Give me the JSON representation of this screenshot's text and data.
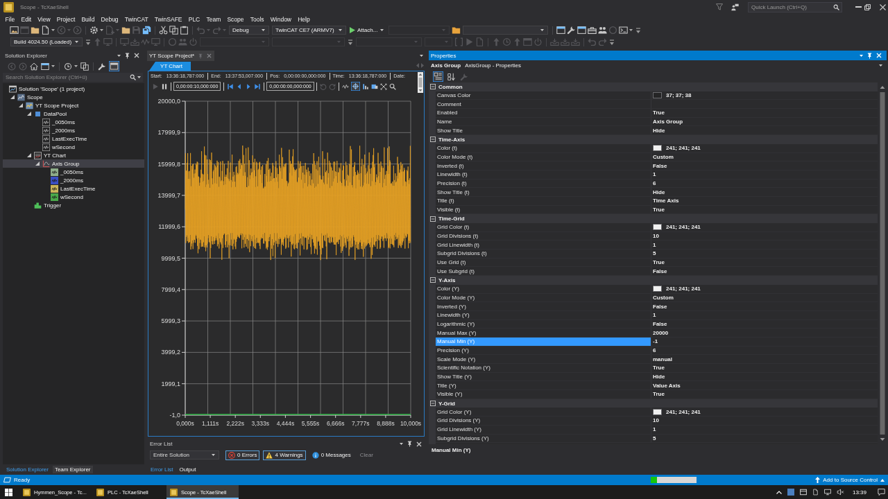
{
  "window": {
    "title": "Scope - TcXaeShell",
    "quick_launch": {
      "placeholder": "Quick Launch (Ctrl+Q)"
    }
  },
  "menu": [
    "File",
    "Edit",
    "View",
    "Project",
    "Build",
    "Debug",
    "TwinCAT",
    "TwinSAFE",
    "PLC",
    "Team",
    "Scope",
    "Tools",
    "Window",
    "Help"
  ],
  "toolbar_1": [
    {
      "kind": "icon",
      "disabled": false
    },
    {
      "kind": "icon",
      "disabled": true
    },
    {
      "kind": "icon",
      "disabled": false
    },
    {
      "kind": "split",
      "disabled": false
    },
    {
      "kind": "split",
      "disabled": true
    },
    {
      "kind": "icon",
      "disabled": true
    },
    {
      "kind": "separator"
    },
    {
      "kind": "split",
      "disabled": false
    },
    {
      "kind": "split",
      "disabled": true
    },
    {
      "kind": "icon",
      "disabled": false
    },
    {
      "kind": "icon",
      "disabled": true
    },
    {
      "kind": "icon",
      "disabled": false
    },
    {
      "kind": "separator"
    },
    {
      "kind": "icon",
      "disabled": false
    },
    {
      "kind": "icon",
      "disabled": false
    },
    {
      "kind": "icon",
      "disabled": false
    },
    {
      "kind": "separator"
    },
    {
      "kind": "split",
      "disabled": true
    },
    {
      "kind": "split",
      "disabled": true
    },
    {
      "kind": "dropdown",
      "value": "Debug",
      "disabled": false
    },
    {
      "kind": "dropdown",
      "value": "TwinCAT CE7 (ARMV7)",
      "disabled": false
    },
    {
      "kind": "button",
      "label": "Attach...",
      "disabled": false
    },
    {
      "kind": "dropdown",
      "disabled": true
    },
    {
      "kind": "icon",
      "disabled": false
    },
    {
      "kind": "dropdown",
      "disabled": false
    },
    {
      "kind": "separator"
    },
    {
      "kind": "icon",
      "disabled": false
    },
    {
      "kind": "icon",
      "disabled": false
    },
    {
      "kind": "icon",
      "disabled": false
    },
    {
      "kind": "icon",
      "disabled": false
    },
    {
      "kind": "icon",
      "disabled": false
    },
    {
      "kind": "icon",
      "disabled": true
    },
    {
      "kind": "split",
      "disabled": false
    },
    {
      "kind": "overflow"
    }
  ],
  "toolbar_2": [
    {
      "kind": "dropdown",
      "value": "Build 4024.50 (Loaded)",
      "disabled": false
    },
    {
      "kind": "overflow"
    },
    {
      "kind": "icon",
      "disabled": true
    },
    {
      "kind": "icon",
      "disabled": true
    },
    {
      "kind": "separator"
    },
    {
      "kind": "icon",
      "disabled": true
    },
    {
      "kind": "icon",
      "disabled": true
    },
    {
      "kind": "icon",
      "disabled": true
    },
    {
      "kind": "icon",
      "disabled": true
    },
    {
      "kind": "separator"
    },
    {
      "kind": "icon",
      "disabled": true
    },
    {
      "kind": "icon",
      "disabled": true
    },
    {
      "kind": "icon",
      "disabled": true
    },
    {
      "kind": "dropdown",
      "disabled": true
    },
    {
      "kind": "dropdown",
      "disabled": true
    },
    {
      "kind": "overflow"
    },
    {
      "kind": "dropdown",
      "disabled": true
    },
    {
      "kind": "dropdown",
      "disabled": true
    },
    {
      "kind": "icon",
      "disabled": true
    },
    {
      "kind": "icon",
      "disabled": true
    },
    {
      "kind": "icon",
      "disabled": true
    },
    {
      "kind": "separator"
    },
    {
      "kind": "icon",
      "disabled": true
    },
    {
      "kind": "icon",
      "disabled": true
    },
    {
      "kind": "icon",
      "disabled": true
    },
    {
      "kind": "icon",
      "disabled": true
    },
    {
      "kind": "icon",
      "disabled": true
    },
    {
      "kind": "separator"
    },
    {
      "kind": "icon",
      "disabled": true
    },
    {
      "kind": "icon",
      "disabled": true
    },
    {
      "kind": "icon",
      "disabled": true
    },
    {
      "kind": "separator"
    },
    {
      "kind": "icon",
      "disabled": true
    },
    {
      "kind": "icon",
      "disabled": true
    },
    {
      "kind": "overflow"
    }
  ],
  "solution_explorer": {
    "title": "Solution Explorer",
    "toolbar": [
      {
        "kind": "icon",
        "disabled": true,
        "selected": false
      },
      {
        "kind": "icon",
        "disabled": true,
        "selected": false
      },
      {
        "kind": "icon",
        "disabled": false,
        "selected": false
      },
      {
        "kind": "split",
        "disabled": false,
        "selected": false
      },
      {
        "kind": "separator"
      },
      {
        "kind": "split",
        "disabled": false,
        "selected": false
      },
      {
        "kind": "icon",
        "disabled": false,
        "selected": false
      },
      {
        "kind": "separator"
      },
      {
        "kind": "icon",
        "disabled": false,
        "selected": false
      },
      {
        "kind": "icon",
        "disabled": false,
        "selected": true
      }
    ],
    "search": {
      "placeholder": "Search Solution Explorer (Ctrl+ü)"
    },
    "tree": [
      {
        "label": "Solution 'Scope' (1 project)",
        "kind": "solution",
        "selected": false,
        "children": [
          {
            "label": "Scope",
            "kind": "scope",
            "expanded": true,
            "selected": false,
            "children": [
              {
                "label": "YT Scope Project",
                "kind": "project",
                "expanded": true,
                "selected": false,
                "children": [
                  {
                    "label": "DataPool",
                    "kind": "datapool",
                    "expanded": true,
                    "selected": false,
                    "children": [
                      {
                        "label": "_0050ms",
                        "kind": "variable",
                        "selected": false
                      },
                      {
                        "label": "_2000ms",
                        "kind": "variable",
                        "selected": false
                      },
                      {
                        "label": "LastExecTime",
                        "kind": "variable",
                        "selected": false
                      },
                      {
                        "label": "wSecond",
                        "kind": "variable",
                        "selected": false
                      }
                    ]
                  },
                  {
                    "label": "YT Chart",
                    "kind": "chart",
                    "expanded": true,
                    "selected": false,
                    "children": [
                      {
                        "label": "Axis Group",
                        "kind": "axis_group",
                        "expanded": true,
                        "selected": true,
                        "children": [
                          {
                            "label": "_0050ms",
                            "kind": "channel",
                            "color": "#8fae8a",
                            "selected": false
                          },
                          {
                            "label": "_2000ms",
                            "kind": "channel",
                            "color": "#3a4fc4",
                            "selected": false
                          },
                          {
                            "label": "LastExecTime",
                            "kind": "channel",
                            "color": "#c9b45a",
                            "selected": false
                          },
                          {
                            "label": "wSecond",
                            "kind": "channel",
                            "color": "#4aa84a",
                            "selected": false
                          }
                        ]
                      }
                    ]
                  },
                  {
                    "label": "Trigger",
                    "kind": "trigger",
                    "selected": false
                  }
                ]
              }
            ]
          }
        ]
      }
    ],
    "tabs": [
      {
        "label": "Solution Explorer",
        "selected": true
      },
      {
        "label": "Team Explorer",
        "selected": false
      }
    ]
  },
  "document": {
    "tabs": [
      {
        "label": "YT Scope Project*",
        "selected": true
      }
    ],
    "views": [
      {
        "label": "YT Chart",
        "selected": true
      }
    ],
    "info": [
      {
        "label": "Start:",
        "value": "13:36:18,787:000"
      },
      {
        "label": "End:",
        "value": "13:37:53,007:000"
      },
      {
        "label": "Pos:",
        "value": "0,00:00:00,000:000"
      },
      {
        "label": "Time:",
        "value": "13:36:18,787:000"
      },
      {
        "label": "Date:"
      }
    ],
    "controls": [
      {
        "kind": "icon",
        "disabled": true,
        "selected": false
      },
      {
        "kind": "icon",
        "disabled": false,
        "selected": false
      },
      {
        "kind": "separator"
      },
      {
        "kind": "field",
        "value": "0,00:00:10,000:000"
      },
      {
        "kind": "separator"
      },
      {
        "kind": "icon",
        "disabled": false,
        "selected": false
      },
      {
        "kind": "icon",
        "disabled": false,
        "selected": false
      },
      {
        "kind": "icon",
        "disabled": false,
        "selected": false
      },
      {
        "kind": "icon",
        "disabled": false,
        "selected": false
      },
      {
        "kind": "separator"
      },
      {
        "kind": "field",
        "value": "0,00:00:00,000:000"
      },
      {
        "kind": "separator"
      },
      {
        "kind": "icon",
        "disabled": true,
        "selected": false
      },
      {
        "kind": "icon",
        "disabled": true,
        "selected": false
      },
      {
        "kind": "separator"
      },
      {
        "kind": "icon",
        "disabled": false,
        "selected": false
      },
      {
        "kind": "icon",
        "disabled": false,
        "selected": true
      },
      {
        "kind": "icon",
        "disabled": false,
        "selected": false
      },
      {
        "kind": "icon",
        "disabled": false,
        "selected": false
      },
      {
        "kind": "icon",
        "disabled": false,
        "selected": false
      },
      {
        "kind": "icon",
        "disabled": false,
        "selected": false
      }
    ],
    "chart": {
      "y_labels": [
        "20000,0",
        "17999,9",
        "15999,8",
        "13999,7",
        "11999,6",
        "9999,5",
        "7999,4",
        "5999,3",
        "3999,2",
        "1999,1",
        "-1,0"
      ],
      "x_labels": [
        "0,000s",
        "1,111s",
        "2,222s",
        "3,333s",
        "4,444s",
        "5,555s",
        "6,666s",
        "7,777s",
        "8,888s",
        "10,000s"
      ]
    }
  },
  "error_list": {
    "title": "Error List",
    "scope": "Entire Solution",
    "filters": [
      {
        "kind": "errors",
        "label": "0 Errors",
        "selected": true
      },
      {
        "kind": "warnings",
        "label": "4 Warnings",
        "selected": true
      },
      {
        "kind": "messages",
        "label": "0 Messages",
        "selected": false
      }
    ],
    "clear": {
      "label": "Clear",
      "disabled": true
    },
    "tabs": [
      {
        "label": "Error List",
        "selected": true
      },
      {
        "label": "Output",
        "selected": false
      }
    ]
  },
  "properties": {
    "title": "Properties",
    "object": {
      "name": "Axis Group",
      "type": "AxisGroup - Properties"
    },
    "view_buttons": [
      {
        "kind": "icon",
        "disabled": false,
        "selected": true
      },
      {
        "kind": "icon",
        "disabled": false,
        "selected": false
      },
      {
        "kind": "icon",
        "disabled": true,
        "selected": false
      }
    ],
    "categories": [
      {
        "name": "Common",
        "expanded": true,
        "rows": [
          {
            "name": "Canvas Color",
            "value": "37; 37; 38",
            "color": "#252526",
            "selected": false
          },
          {
            "name": "Comment",
            "selected": false
          },
          {
            "name": "Enabled",
            "value": "True",
            "selected": false
          },
          {
            "name": "Name",
            "value": "Axis Group",
            "selected": false
          },
          {
            "name": "Show Title",
            "value": "Hide",
            "selected": false
          }
        ]
      },
      {
        "name": "Time-Axis",
        "expanded": true,
        "rows": [
          {
            "name": "Color (t)",
            "value": "241; 241; 241",
            "color": "#f1f1f1",
            "selected": false
          },
          {
            "name": "Color Mode (t)",
            "value": "Custom",
            "selected": false
          },
          {
            "name": "Inverted (t)",
            "value": "False",
            "selected": false
          },
          {
            "name": "Linewidth (t)",
            "value": "1",
            "selected": false
          },
          {
            "name": "Precision (t)",
            "value": "6",
            "selected": false
          },
          {
            "name": "Show Title (t)",
            "value": "Hide",
            "selected": false
          },
          {
            "name": "Title (t)",
            "value": "Time Axis",
            "selected": false
          },
          {
            "name": "Visible (t)",
            "value": "True",
            "selected": false
          }
        ]
      },
      {
        "name": "Time-Grid",
        "expanded": true,
        "rows": [
          {
            "name": "Grid Color (t)",
            "value": "241; 241; 241",
            "color": "#f1f1f1",
            "selected": false
          },
          {
            "name": "Grid Divisions (t)",
            "value": "10",
            "selected": false
          },
          {
            "name": "Grid Linewidth (t)",
            "value": "1",
            "selected": false
          },
          {
            "name": "Subgrid Divisions (t)",
            "value": "5",
            "selected": false
          },
          {
            "name": "Use Grid (t)",
            "value": "True",
            "selected": false
          },
          {
            "name": "Use Subgrid (t)",
            "value": "False",
            "selected": false
          }
        ]
      },
      {
        "name": "Y-Axis",
        "expanded": true,
        "rows": [
          {
            "name": "Color (Y)",
            "value": "241; 241; 241",
            "color": "#f1f1f1",
            "selected": false
          },
          {
            "name": "Color Mode (Y)",
            "value": "Custom",
            "selected": false
          },
          {
            "name": "Inverted (Y)",
            "value": "False",
            "selected": false
          },
          {
            "name": "Linewidth (Y)",
            "value": "1",
            "selected": false
          },
          {
            "name": "Logarithmic (Y)",
            "value": "False",
            "selected": false
          },
          {
            "name": "Manual Max (Y)",
            "value": "20000",
            "selected": false
          },
          {
            "name": "Manual Min (Y)",
            "value": "-1",
            "selected": true
          },
          {
            "name": "Precision (Y)",
            "value": "6",
            "selected": false
          },
          {
            "name": "Scale Mode (Y)",
            "value": "manual",
            "selected": false
          },
          {
            "name": "Scientific Notation (Y)",
            "value": "True",
            "selected": false
          },
          {
            "name": "Show Title (Y)",
            "value": "Hide",
            "selected": false
          },
          {
            "name": "Title (Y)",
            "value": "Value Axis",
            "selected": false
          },
          {
            "name": "Visible (Y)",
            "value": "True",
            "selected": false
          }
        ]
      },
      {
        "name": "Y-Grid",
        "expanded": true,
        "rows": [
          {
            "name": "Grid Color (Y)",
            "value": "241; 241; 241",
            "color": "#f1f1f1",
            "selected": false
          },
          {
            "name": "Grid Divisions (Y)",
            "value": "10",
            "selected": false
          },
          {
            "name": "Grid Linewidth (Y)",
            "value": "1",
            "selected": false
          },
          {
            "name": "Subgrid Divisions (Y)",
            "value": "5",
            "selected": false
          }
        ]
      }
    ],
    "description": "Manual Min (Y)"
  },
  "status_bar": {
    "text": "Ready",
    "progress": {
      "level": 0.14
    },
    "source_control": "Add to Source Control"
  },
  "taskbar": {
    "tasks": [
      {
        "label": "Hymmen_Scope - Tc...",
        "selected": false
      },
      {
        "label": "PLC - TcXaeShell",
        "selected": false
      },
      {
        "label": "Scope - TcXaeShell",
        "selected": true
      }
    ],
    "clock": "13:39"
  }
}
